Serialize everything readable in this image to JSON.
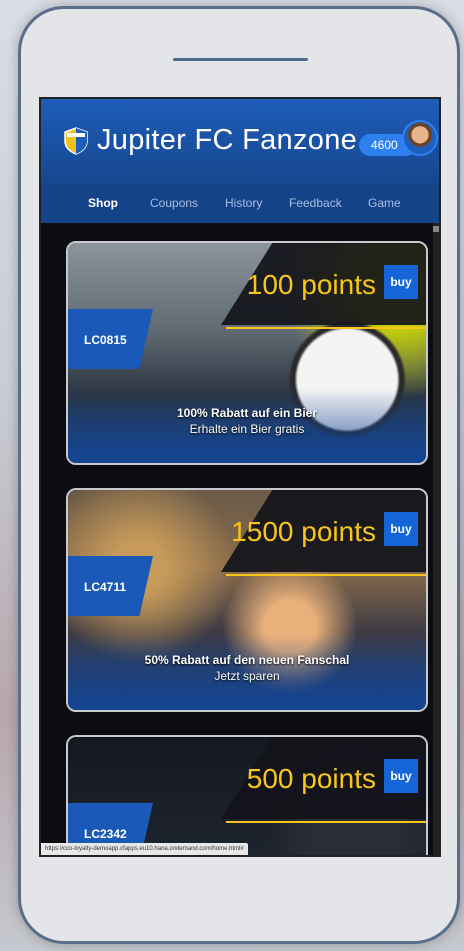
{
  "app": {
    "title": "Jupiter FC Fanzone",
    "points_balance": "4600"
  },
  "tabs": [
    {
      "label": "Shop",
      "active": true
    },
    {
      "label": "Coupons",
      "active": false
    },
    {
      "label": "History",
      "active": false
    },
    {
      "label": "Feedback",
      "active": false
    },
    {
      "label": "Game",
      "active": false
    }
  ],
  "offers": [
    {
      "price": "100 points",
      "buy_label": "buy",
      "code": "LC0815",
      "line1": "100% Rabatt auf ein Bier",
      "line2": "Erhalte ein Bier gratis"
    },
    {
      "price": "1500 points",
      "buy_label": "buy",
      "code": "LC4711",
      "line1": "50% Rabatt auf den neuen Fanschal",
      "line2": "Jetzt sparen"
    },
    {
      "price": "500 points",
      "buy_label": "buy",
      "code": "LC2342",
      "line1": "",
      "line2": ""
    }
  ],
  "status_bar": {
    "url": "https://cco-loyalty-demoapp.cfapps.eu10.hana.ondemand.com/home.html#"
  },
  "colors": {
    "appbar_blue": "#1e5dba",
    "accent_yellow": "#f7c51c",
    "buy_blue": "#1565d8"
  }
}
